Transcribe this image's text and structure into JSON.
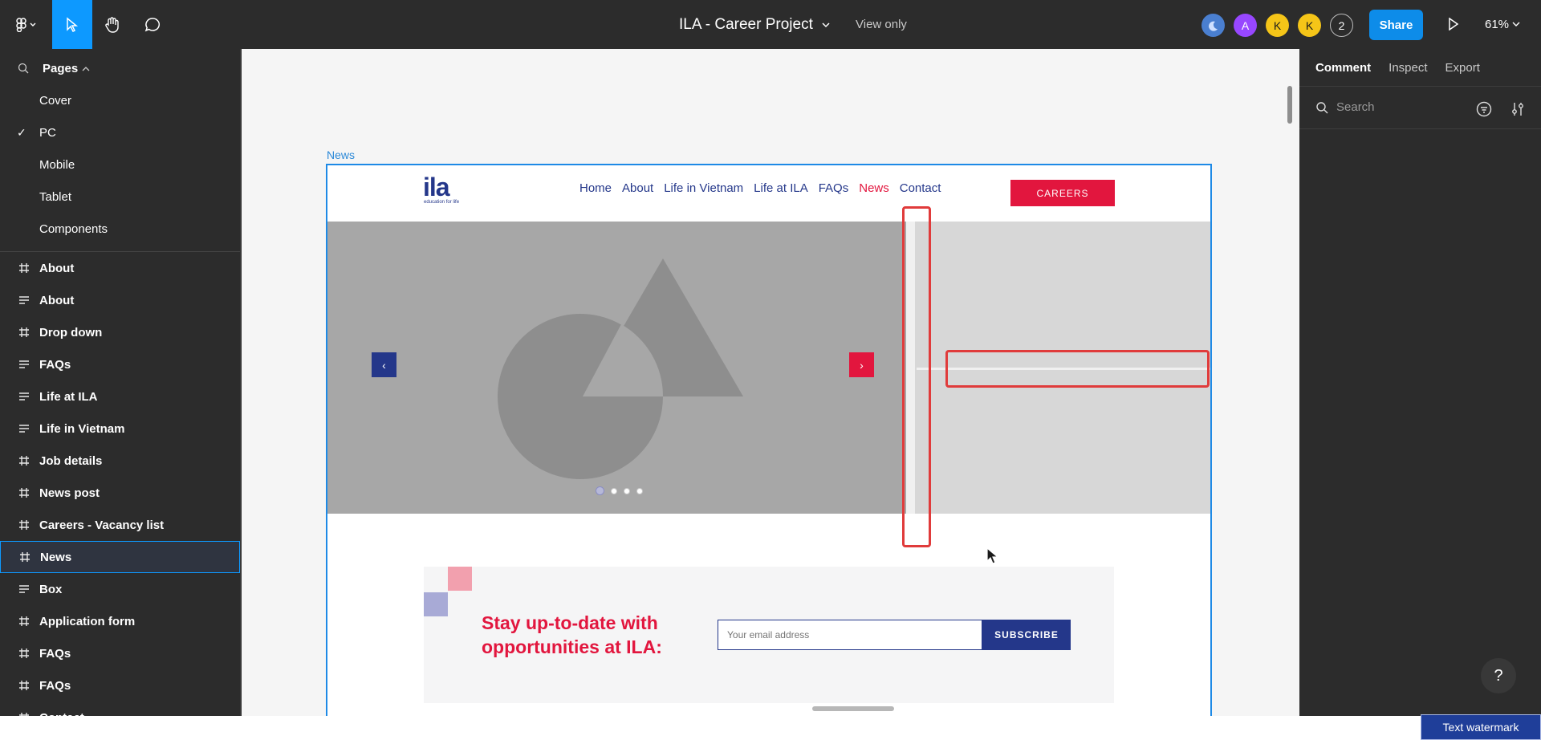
{
  "topbar": {
    "file_title": "ILA - Career Project",
    "view_mode": "View only",
    "avatars": [
      {
        "letter": "",
        "color": "#4a7fd0"
      },
      {
        "letter": "A",
        "color": "#9747ff"
      },
      {
        "letter": "K",
        "color": "#f5c518"
      },
      {
        "letter": "K",
        "color": "#f5c518"
      }
    ],
    "extra_users": "2",
    "share_label": "Share",
    "zoom": "61%"
  },
  "sidebar": {
    "pages_label": "Pages",
    "pages": [
      {
        "label": "Cover",
        "checked": false
      },
      {
        "label": "PC",
        "checked": true
      },
      {
        "label": "Mobile",
        "checked": false
      },
      {
        "label": "Tablet",
        "checked": false
      },
      {
        "label": "Components",
        "checked": false
      }
    ],
    "layers": [
      {
        "label": "About",
        "icon": "frame-icon"
      },
      {
        "label": "About",
        "icon": "text-align-icon"
      },
      {
        "label": "Drop down",
        "icon": "frame-icon"
      },
      {
        "label": "FAQs",
        "icon": "text-align-icon"
      },
      {
        "label": "Life at ILA",
        "icon": "text-align-icon"
      },
      {
        "label": "Life in Vietnam",
        "icon": "text-align-icon"
      },
      {
        "label": "Job details",
        "icon": "frame-icon"
      },
      {
        "label": "News post",
        "icon": "frame-icon"
      },
      {
        "label": "Careers - Vacancy list",
        "icon": "frame-icon"
      },
      {
        "label": "News",
        "icon": "frame-icon",
        "selected": true
      },
      {
        "label": "Box",
        "icon": "text-align-icon"
      },
      {
        "label": "Application form",
        "icon": "frame-icon"
      },
      {
        "label": "FAQs",
        "icon": "frame-icon"
      },
      {
        "label": "FAQs",
        "icon": "frame-icon"
      },
      {
        "label": "Contact",
        "icon": "frame-icon"
      }
    ]
  },
  "canvas": {
    "frame_label": "News",
    "site": {
      "logo_text": "ila",
      "logo_tagline": "education for life",
      "nav": [
        "Home",
        "About",
        "Life in Vietnam",
        "Life at ILA",
        "FAQs",
        "News",
        "Contact"
      ],
      "nav_active": "News",
      "careers_label": "CAREERS",
      "arrow_left": "‹",
      "arrow_right": "›",
      "newsletter_line1": "Stay up-to-date with",
      "newsletter_line2": "opportunities at ILA:",
      "email_placeholder": "Your email address",
      "subscribe_label": "SUBSCRIBE"
    }
  },
  "rightpanel": {
    "tabs": [
      "Comment",
      "Inspect",
      "Export"
    ],
    "active_tab": "Comment",
    "search_placeholder": "Search"
  },
  "help_label": "?",
  "watermark": "Text watermark",
  "colors": {
    "accent_blue": "#0d99ff",
    "brand_navy": "#24378a",
    "brand_red": "#e2163e",
    "highlight_red": "#e03b3b"
  }
}
